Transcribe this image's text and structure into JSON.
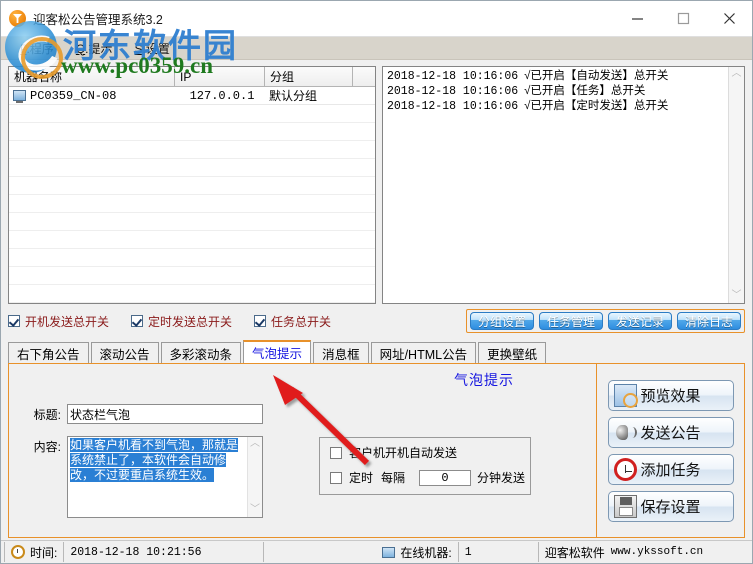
{
  "window": {
    "title": "迎客松公告管理系统3.2",
    "icon": "app-logo-icon",
    "minimize": "—",
    "maximize": "□",
    "close": "✕"
  },
  "menu": {
    "items": [
      {
        "accel": "P",
        "label": ".程序"
      },
      {
        "accel": "Q",
        "label": ".提示"
      },
      {
        "accel": "S",
        "label": ".设置"
      }
    ]
  },
  "machine_list": {
    "columns": [
      "机器名称",
      "IP",
      "分组",
      ""
    ],
    "rows": [
      {
        "name": "PC0359_CN-08",
        "ip": "127.0.0.1",
        "group": "默认分组",
        "extra": ""
      }
    ]
  },
  "log": {
    "lines": [
      {
        "time": "2018-12-18  10:16:06",
        "message": "√已开启【自动发送】总开关"
      },
      {
        "time": "2018-12-18  10:16:06",
        "message": "√已开启【任务】总开关"
      },
      {
        "time": "2018-12-18  10:16:06",
        "message": "√已开启【定时发送】总开关"
      }
    ],
    "scroll_up": "︿",
    "scroll_down": "﹀"
  },
  "options": {
    "checks": [
      {
        "label": "开机发送总开关",
        "checked": true
      },
      {
        "label": "定时发送总开关",
        "checked": true
      },
      {
        "label": "任务总开关",
        "checked": true
      }
    ],
    "buttons": [
      {
        "label": "分组设置"
      },
      {
        "label": "任务管理"
      },
      {
        "label": "发送记录"
      },
      {
        "label": "清除日志"
      }
    ]
  },
  "tabs": [
    {
      "label": "右下角公告",
      "active": false
    },
    {
      "label": "滚动公告",
      "active": false
    },
    {
      "label": "多彩滚动条",
      "active": false
    },
    {
      "label": "气泡提示",
      "active": true
    },
    {
      "label": "消息框",
      "active": false
    },
    {
      "label": "网址/HTML公告",
      "active": false
    },
    {
      "label": "更换壁纸",
      "active": false
    }
  ],
  "form": {
    "heading": "气泡提示",
    "title_label": "标题:",
    "title_value": "状态栏气泡",
    "content_label": "内容:",
    "content_value": "如果客户机看不到气泡，那就是系统禁止了，本软件会自动修改，不过要重启系统生效。",
    "scroll_up": "︿",
    "scroll_down": "﹀",
    "auto_send": {
      "label": "客户机开机自动发送",
      "checked": false
    },
    "timer": {
      "label": "定时",
      "interval_label": "每隔",
      "interval_value": "0",
      "unit_label": "分钟发送",
      "checked": false
    }
  },
  "actions": [
    {
      "label": "预览效果",
      "icon": "preview-icon"
    },
    {
      "label": "发送公告",
      "icon": "speaker-icon"
    },
    {
      "label": "添加任务",
      "icon": "clock-icon"
    },
    {
      "label": "保存设置",
      "icon": "save-icon"
    }
  ],
  "statusbar": {
    "time_label": "时间:",
    "time_value": "2018-12-18  10:21:56",
    "online_label": "在线机器:",
    "online_value": "1",
    "brand": "迎客松软件",
    "brand_url": "www.ykssoft.cn"
  },
  "watermark": {
    "site_cn": "河东软件园",
    "site_url": "www.pc0359.cn"
  },
  "colors": {
    "accent_orange": "#e8912a",
    "active_tab_text": "#1515e0",
    "check_label": "#8a1a1a",
    "button_blue": "#2e8de0",
    "selection_blue": "#2a7fd4"
  }
}
